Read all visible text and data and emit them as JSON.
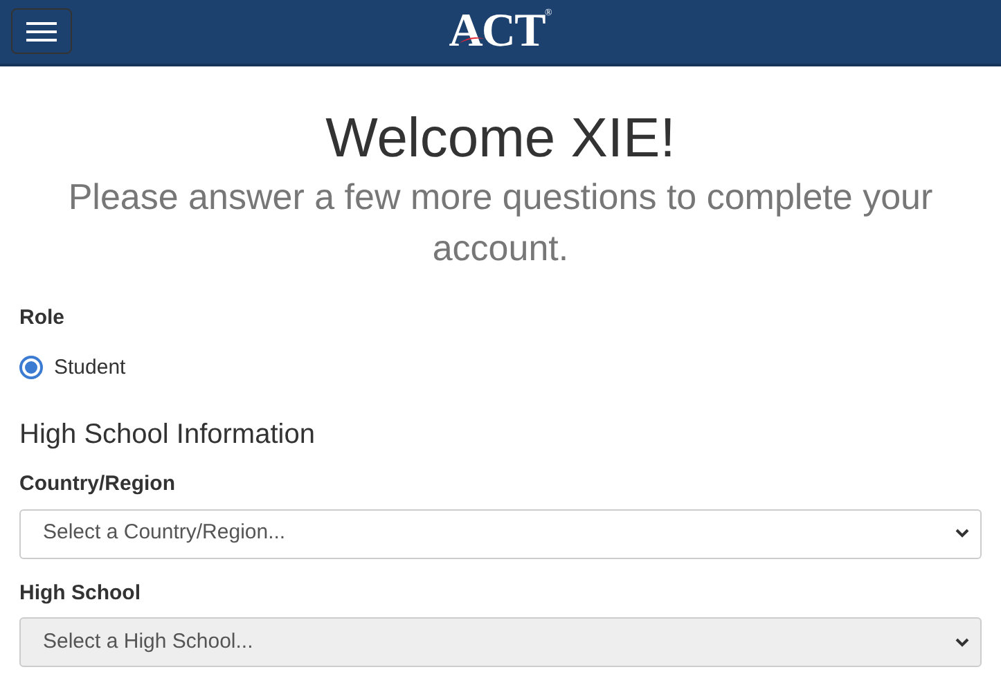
{
  "header": {
    "logo": "ACT",
    "logo_mark": "®"
  },
  "heading": "Welcome XIE!",
  "subheading": "Please answer a few more questions to complete your account.",
  "role": {
    "label": "Role",
    "options": [
      {
        "label": "Student",
        "selected": true
      }
    ]
  },
  "section_title": "High School Information",
  "fields": [
    {
      "label": "Country/Region",
      "placeholder": "Select a Country/Region...",
      "disabled": false
    },
    {
      "label": "High School",
      "placeholder": "Select a High School...",
      "disabled": true
    }
  ]
}
